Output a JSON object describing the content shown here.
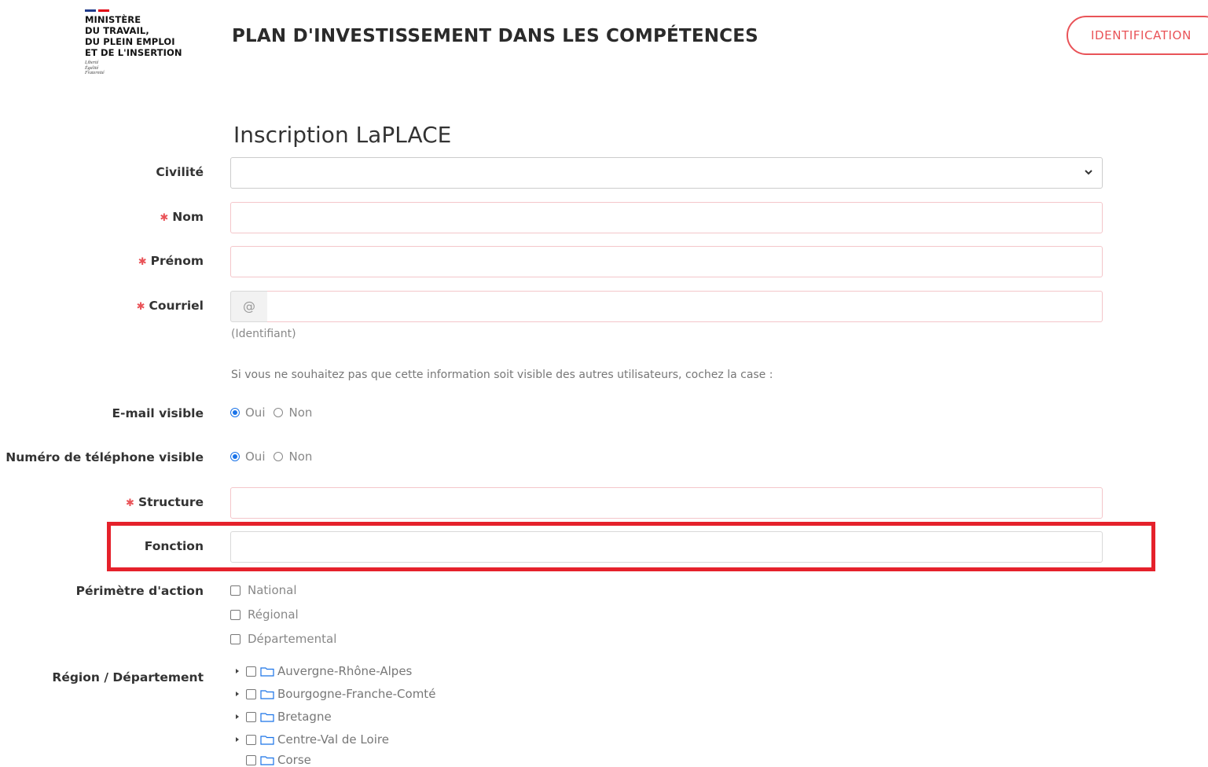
{
  "header": {
    "logo_lines": "MINISTÈRE\nDU TRAVAIL,\nDU PLEIN EMPLOI\nET DE L'INSERTION",
    "logo_motto": "Liberté\nÉgalité\nFraternité",
    "title": "PLAN D'INVESTISSEMENT DANS LES COMPÉTENCES",
    "ident_button": "IDENTIFICATION"
  },
  "form": {
    "title": "Inscription LaPLACE",
    "civilite_label": "Civilité",
    "civilite_value": "",
    "nom_label": "Nom",
    "nom_value": "",
    "prenom_label": "Prénom",
    "prenom_value": "",
    "courriel_label": "Courriel",
    "courriel_addon": "@",
    "courriel_value": "",
    "courriel_help": "(Identifiant)",
    "visibility_note": "Si vous ne souhaitez pas que cette information soit visible des autres utilisateurs, cochez la case :",
    "email_visible_label": "E-mail visible",
    "phone_visible_label": "Numéro de téléphone visible",
    "yes": "Oui",
    "no": "Non",
    "email_visible_selected": "Oui",
    "phone_visible_selected": "Oui",
    "structure_label": "Structure",
    "structure_value": "",
    "fonction_label": "Fonction",
    "fonction_value": "",
    "perimetre_label": "Périmètre d'action",
    "perimetre_options": [
      "National",
      "Régional",
      "Départemental"
    ],
    "region_label": "Région / Département",
    "regions": [
      "Auvergne-Rhône-Alpes",
      "Bourgogne-Franche-Comté",
      "Bretagne",
      "Centre-Val de Loire",
      "Corse"
    ]
  },
  "colors": {
    "accent_red": "#e95358",
    "highlight_red": "#e5212b",
    "radio_blue": "#1a73e8"
  }
}
